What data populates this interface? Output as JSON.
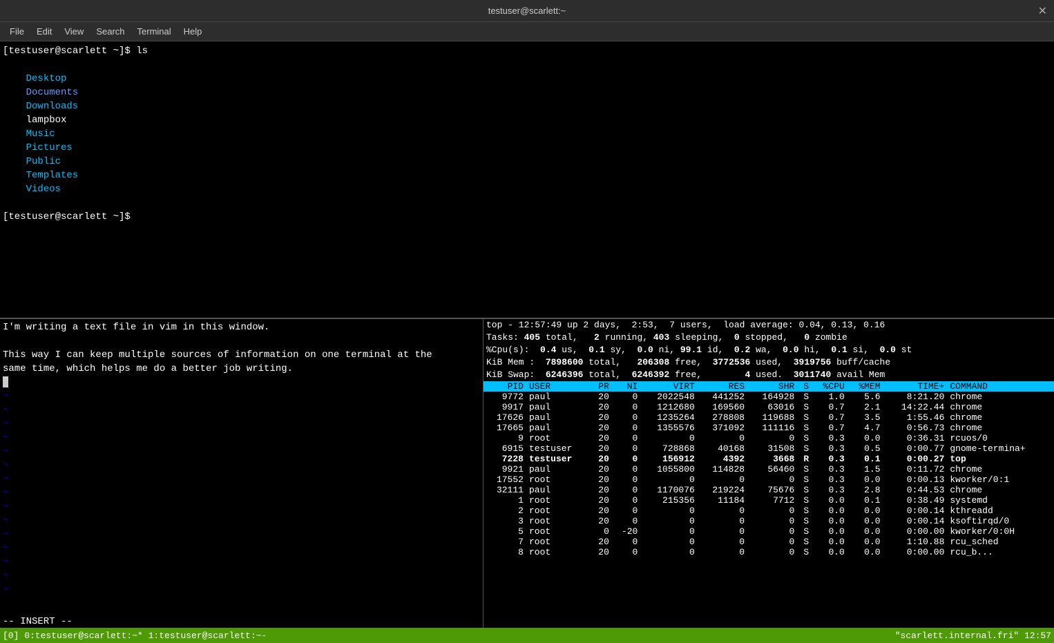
{
  "titlebar": {
    "title": "testuser@scarlett:~",
    "close_label": "✕"
  },
  "menubar": {
    "items": [
      "File",
      "Edit",
      "View",
      "Search",
      "Terminal",
      "Help"
    ]
  },
  "terminal_top": {
    "prompt1": "[testuser@scarlett ~]$ ls",
    "ls_output": {
      "items": [
        {
          "text": "Desktop",
          "color": "cyan"
        },
        {
          "text": "Documents",
          "color": "blue"
        },
        {
          "text": "Downloads",
          "color": "cyan"
        },
        {
          "text": "lampbox",
          "color": "white"
        },
        {
          "text": "Music",
          "color": "cyan"
        },
        {
          "text": "Pictures",
          "color": "cyan"
        },
        {
          "text": "Public",
          "color": "cyan"
        },
        {
          "text": "Templates",
          "color": "cyan"
        },
        {
          "text": "Videos",
          "color": "cyan"
        }
      ]
    },
    "prompt2": "[testuser@scarlett ~]$ "
  },
  "vim": {
    "lines": [
      "I'm writing a text file in vim in this window.",
      "",
      "This way I can keep multiple sources of information on one terminal at the",
      "same time, which helps me do a better job writing."
    ],
    "tilde_count": 15,
    "status": "-- INSERT --",
    "tab0": "0:testuser@scarlett:~*",
    "tab1": "1:testuser@scarlett:~-"
  },
  "top": {
    "header": {
      "line1": "top - 12:57:49 up 2 days,  2:53,  7 users,  load average: 0.04, 0.13, 0.16",
      "line2_pre": "Tasks: ",
      "line2_405": "405",
      "line2_mid1": " total,   ",
      "line2_2": "2",
      "line2_mid2": " running, ",
      "line2_403": "403",
      "line2_mid3": " sleeping,  ",
      "line2_0a": "0",
      "line2_mid4": " stopped,   ",
      "line2_0b": "0",
      "line2_end": " zombie",
      "line2": "Tasks: 405 total,   2 running, 403 sleeping,  0 stopped,   0 zombie",
      "line3": "%Cpu(s):  0.4 us,  0.1 sy,  0.0 ni, 99.1 id,  0.2 wa,  0.0 hi,  0.1 si,  0.0 st",
      "line4": "KiB Mem :  7898600 total,   206308 free,  3772536 used,  3919756 buff/cache",
      "line5": "KiB Swap:  6246396 total,  6246392 free,        4 used.  3011740 avail Mem"
    },
    "table_headers": [
      "PID",
      "USER",
      "PR",
      "NI",
      "VIRT",
      "RES",
      "SHR",
      "S",
      "%CPU",
      "%MEM",
      "TIME+",
      "COMMAND"
    ],
    "processes": [
      {
        "pid": "9772",
        "user": "paul",
        "pr": "20",
        "ni": "0",
        "virt": "2022548",
        "res": "441252",
        "shr": "164928",
        "s": "S",
        "cpu": "1.0",
        "mem": "5.6",
        "time": "8:21.20",
        "cmd": "chrome",
        "highlight": false
      },
      {
        "pid": "9917",
        "user": "paul",
        "pr": "20",
        "ni": "0",
        "virt": "1212680",
        "res": "169560",
        "shr": "63016",
        "s": "S",
        "cpu": "0.7",
        "mem": "2.1",
        "time": "14:22.44",
        "cmd": "chrome",
        "highlight": false
      },
      {
        "pid": "17626",
        "user": "paul",
        "pr": "20",
        "ni": "0",
        "virt": "1235264",
        "res": "278808",
        "shr": "119688",
        "s": "S",
        "cpu": "0.7",
        "mem": "3.5",
        "time": "1:55.46",
        "cmd": "chrome",
        "highlight": false
      },
      {
        "pid": "17665",
        "user": "paul",
        "pr": "20",
        "ni": "0",
        "virt": "1355576",
        "res": "371092",
        "shr": "111116",
        "s": "S",
        "cpu": "0.7",
        "mem": "4.7",
        "time": "0:56.73",
        "cmd": "chrome",
        "highlight": false
      },
      {
        "pid": "9",
        "user": "root",
        "pr": "20",
        "ni": "0",
        "virt": "0",
        "res": "0",
        "shr": "0",
        "s": "S",
        "cpu": "0.3",
        "mem": "0.0",
        "time": "0:36.31",
        "cmd": "rcuos/0",
        "highlight": false
      },
      {
        "pid": "6915",
        "user": "testuser",
        "pr": "20",
        "ni": "0",
        "virt": "728868",
        "res": "40168",
        "shr": "31508",
        "s": "S",
        "cpu": "0.3",
        "mem": "0.5",
        "time": "0:00.77",
        "cmd": "gnome-termina+",
        "highlight": false
      },
      {
        "pid": "7228",
        "user": "testuser",
        "pr": "20",
        "ni": "0",
        "virt": "156912",
        "res": "4392",
        "shr": "3668",
        "s": "R",
        "cpu": "0.3",
        "mem": "0.1",
        "time": "0:00.27",
        "cmd": "top",
        "highlight": true
      },
      {
        "pid": "9921",
        "user": "paul",
        "pr": "20",
        "ni": "0",
        "virt": "1055800",
        "res": "114828",
        "shr": "56460",
        "s": "S",
        "cpu": "0.3",
        "mem": "1.5",
        "time": "0:11.72",
        "cmd": "chrome",
        "highlight": false
      },
      {
        "pid": "17552",
        "user": "root",
        "pr": "20",
        "ni": "0",
        "virt": "0",
        "res": "0",
        "shr": "0",
        "s": "S",
        "cpu": "0.3",
        "mem": "0.0",
        "time": "0:00.13",
        "cmd": "kworker/0:1",
        "highlight": false
      },
      {
        "pid": "32111",
        "user": "paul",
        "pr": "20",
        "ni": "0",
        "virt": "1170076",
        "res": "219224",
        "shr": "75676",
        "s": "S",
        "cpu": "0.3",
        "mem": "2.8",
        "time": "0:44.53",
        "cmd": "chrome",
        "highlight": false
      },
      {
        "pid": "1",
        "user": "root",
        "pr": "20",
        "ni": "0",
        "virt": "215356",
        "res": "11184",
        "shr": "7712",
        "s": "S",
        "cpu": "0.0",
        "mem": "0.1",
        "time": "0:38.49",
        "cmd": "systemd",
        "highlight": false
      },
      {
        "pid": "2",
        "user": "root",
        "pr": "20",
        "ni": "0",
        "virt": "0",
        "res": "0",
        "shr": "0",
        "s": "S",
        "cpu": "0.0",
        "mem": "0.0",
        "time": "0:00.14",
        "cmd": "kthreadd",
        "highlight": false
      },
      {
        "pid": "3",
        "user": "root",
        "pr": "20",
        "ni": "0",
        "virt": "0",
        "res": "0",
        "shr": "0",
        "s": "S",
        "cpu": "0.0",
        "mem": "0.0",
        "time": "0:00.14",
        "cmd": "ksoftirqd/0",
        "highlight": false
      },
      {
        "pid": "5",
        "user": "root",
        "pr": "0",
        "ni": "-20",
        "virt": "0",
        "res": "0",
        "shr": "0",
        "s": "S",
        "cpu": "0.0",
        "mem": "0.0",
        "time": "0:00.00",
        "cmd": "kworker/0:0H",
        "highlight": false
      },
      {
        "pid": "7",
        "user": "root",
        "pr": "20",
        "ni": "0",
        "virt": "0",
        "res": "0",
        "shr": "0",
        "s": "S",
        "cpu": "0.0",
        "mem": "0.0",
        "time": "1:10.88",
        "cmd": "rcu_sched",
        "highlight": false
      },
      {
        "pid": "8",
        "user": "root",
        "pr": "20",
        "ni": "0",
        "virt": "0",
        "res": "0",
        "shr": "0",
        "s": "S",
        "cpu": "0.0",
        "mem": "0.0",
        "time": "0:00.00",
        "cmd": "rcu_b...",
        "highlight": false
      }
    ]
  },
  "statusbar": {
    "left": "[0] 0:testuser@scarlett:~*  1:testuser@scarlett:~-",
    "right": "\"scarlett.internal.fri\" 12:57"
  },
  "colors": {
    "bg": "#000000",
    "terminal_bg": "#000000",
    "title_bg": "#2d2d2d",
    "cyan": "#00bfff",
    "blue": "#6699ff",
    "green_status": "#4e9a06",
    "top_header_bg": "#00bfff"
  }
}
